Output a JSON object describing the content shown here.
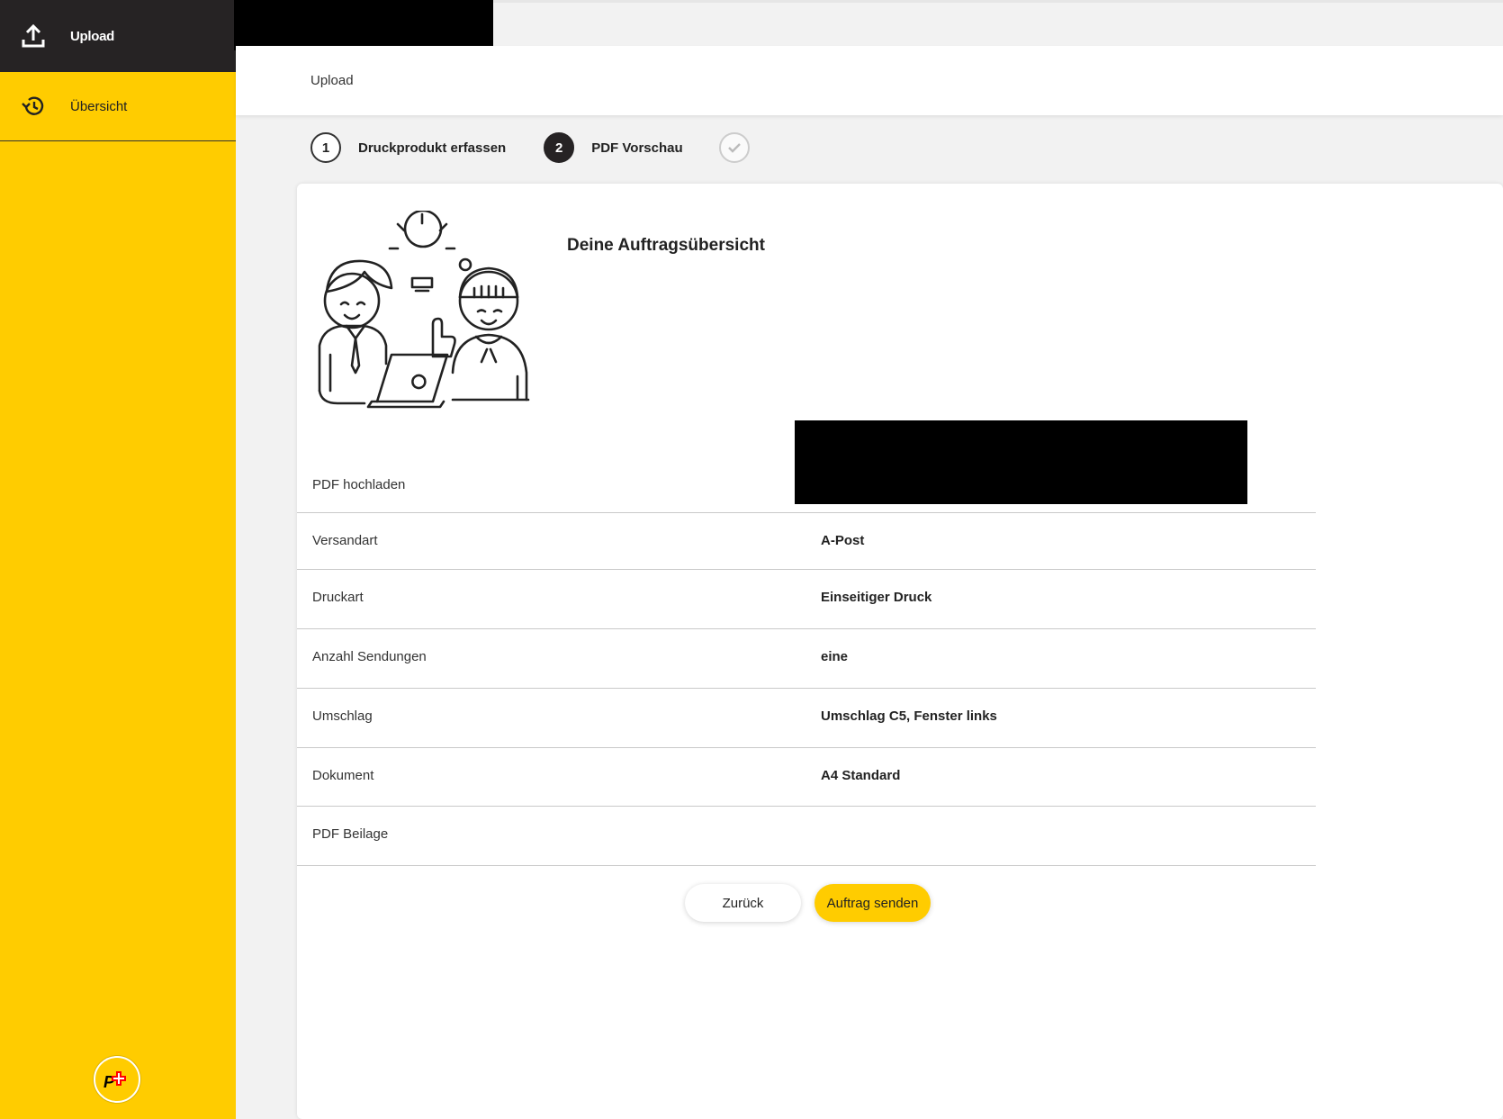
{
  "sidebar": {
    "items": [
      {
        "label": "Upload",
        "icon": "upload-icon",
        "active": true
      },
      {
        "label": "Übersicht",
        "icon": "history-icon",
        "active": false
      }
    ],
    "logo": "swiss-post-logo"
  },
  "header": {
    "breadcrumb": "Upload"
  },
  "stepper": {
    "steps": [
      {
        "number": "1",
        "label": "Druckprodukt erfassen",
        "state": "done"
      },
      {
        "number": "2",
        "label": "PDF Vorschau",
        "state": "current"
      },
      {
        "number": "",
        "label": "",
        "state": "pending",
        "icon": "checkmark-icon"
      }
    ]
  },
  "summary": {
    "title": "Deine Auftragsübersicht",
    "rows": [
      {
        "label": "PDF hochladen",
        "value": ""
      },
      {
        "label": "Versandart",
        "value": "A-Post"
      },
      {
        "label": "Druckart",
        "value": "Einseitiger Druck"
      },
      {
        "label": "Anzahl Sendungen",
        "value": "eine"
      },
      {
        "label": "Umschlag",
        "value": "Umschlag C5, Fenster links"
      },
      {
        "label": "Dokument",
        "value": "A4 Standard"
      },
      {
        "label": "PDF Beilage",
        "value": ""
      }
    ]
  },
  "actions": {
    "back_label": "Zurück",
    "send_label": "Auftrag senden"
  },
  "colors": {
    "brand_yellow": "#ffcc00",
    "dark": "#262324"
  }
}
